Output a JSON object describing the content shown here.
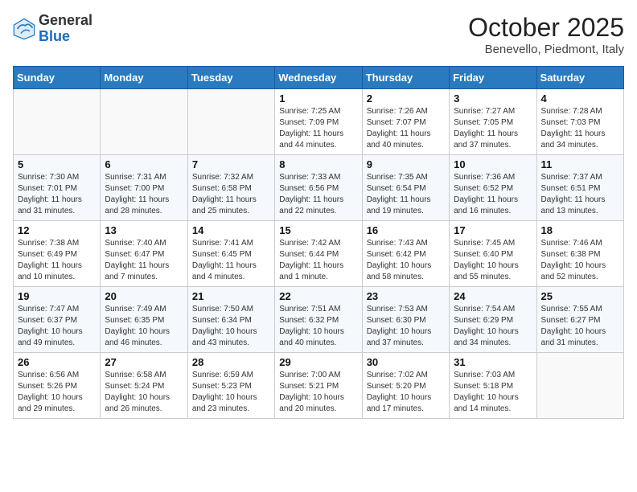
{
  "logo": {
    "general": "General",
    "blue": "Blue"
  },
  "header": {
    "month": "October 2025",
    "location": "Benevello, Piedmont, Italy"
  },
  "weekdays": [
    "Sunday",
    "Monday",
    "Tuesday",
    "Wednesday",
    "Thursday",
    "Friday",
    "Saturday"
  ],
  "weeks": [
    [
      {
        "day": "",
        "info": ""
      },
      {
        "day": "",
        "info": ""
      },
      {
        "day": "",
        "info": ""
      },
      {
        "day": "1",
        "info": "Sunrise: 7:25 AM\nSunset: 7:09 PM\nDaylight: 11 hours\nand 44 minutes."
      },
      {
        "day": "2",
        "info": "Sunrise: 7:26 AM\nSunset: 7:07 PM\nDaylight: 11 hours\nand 40 minutes."
      },
      {
        "day": "3",
        "info": "Sunrise: 7:27 AM\nSunset: 7:05 PM\nDaylight: 11 hours\nand 37 minutes."
      },
      {
        "day": "4",
        "info": "Sunrise: 7:28 AM\nSunset: 7:03 PM\nDaylight: 11 hours\nand 34 minutes."
      }
    ],
    [
      {
        "day": "5",
        "info": "Sunrise: 7:30 AM\nSunset: 7:01 PM\nDaylight: 11 hours\nand 31 minutes."
      },
      {
        "day": "6",
        "info": "Sunrise: 7:31 AM\nSunset: 7:00 PM\nDaylight: 11 hours\nand 28 minutes."
      },
      {
        "day": "7",
        "info": "Sunrise: 7:32 AM\nSunset: 6:58 PM\nDaylight: 11 hours\nand 25 minutes."
      },
      {
        "day": "8",
        "info": "Sunrise: 7:33 AM\nSunset: 6:56 PM\nDaylight: 11 hours\nand 22 minutes."
      },
      {
        "day": "9",
        "info": "Sunrise: 7:35 AM\nSunset: 6:54 PM\nDaylight: 11 hours\nand 19 minutes."
      },
      {
        "day": "10",
        "info": "Sunrise: 7:36 AM\nSunset: 6:52 PM\nDaylight: 11 hours\nand 16 minutes."
      },
      {
        "day": "11",
        "info": "Sunrise: 7:37 AM\nSunset: 6:51 PM\nDaylight: 11 hours\nand 13 minutes."
      }
    ],
    [
      {
        "day": "12",
        "info": "Sunrise: 7:38 AM\nSunset: 6:49 PM\nDaylight: 11 hours\nand 10 minutes."
      },
      {
        "day": "13",
        "info": "Sunrise: 7:40 AM\nSunset: 6:47 PM\nDaylight: 11 hours\nand 7 minutes."
      },
      {
        "day": "14",
        "info": "Sunrise: 7:41 AM\nSunset: 6:45 PM\nDaylight: 11 hours\nand 4 minutes."
      },
      {
        "day": "15",
        "info": "Sunrise: 7:42 AM\nSunset: 6:44 PM\nDaylight: 11 hours\nand 1 minute."
      },
      {
        "day": "16",
        "info": "Sunrise: 7:43 AM\nSunset: 6:42 PM\nDaylight: 10 hours\nand 58 minutes."
      },
      {
        "day": "17",
        "info": "Sunrise: 7:45 AM\nSunset: 6:40 PM\nDaylight: 10 hours\nand 55 minutes."
      },
      {
        "day": "18",
        "info": "Sunrise: 7:46 AM\nSunset: 6:38 PM\nDaylight: 10 hours\nand 52 minutes."
      }
    ],
    [
      {
        "day": "19",
        "info": "Sunrise: 7:47 AM\nSunset: 6:37 PM\nDaylight: 10 hours\nand 49 minutes."
      },
      {
        "day": "20",
        "info": "Sunrise: 7:49 AM\nSunset: 6:35 PM\nDaylight: 10 hours\nand 46 minutes."
      },
      {
        "day": "21",
        "info": "Sunrise: 7:50 AM\nSunset: 6:34 PM\nDaylight: 10 hours\nand 43 minutes."
      },
      {
        "day": "22",
        "info": "Sunrise: 7:51 AM\nSunset: 6:32 PM\nDaylight: 10 hours\nand 40 minutes."
      },
      {
        "day": "23",
        "info": "Sunrise: 7:53 AM\nSunset: 6:30 PM\nDaylight: 10 hours\nand 37 minutes."
      },
      {
        "day": "24",
        "info": "Sunrise: 7:54 AM\nSunset: 6:29 PM\nDaylight: 10 hours\nand 34 minutes."
      },
      {
        "day": "25",
        "info": "Sunrise: 7:55 AM\nSunset: 6:27 PM\nDaylight: 10 hours\nand 31 minutes."
      }
    ],
    [
      {
        "day": "26",
        "info": "Sunrise: 6:56 AM\nSunset: 5:26 PM\nDaylight: 10 hours\nand 29 minutes."
      },
      {
        "day": "27",
        "info": "Sunrise: 6:58 AM\nSunset: 5:24 PM\nDaylight: 10 hours\nand 26 minutes."
      },
      {
        "day": "28",
        "info": "Sunrise: 6:59 AM\nSunset: 5:23 PM\nDaylight: 10 hours\nand 23 minutes."
      },
      {
        "day": "29",
        "info": "Sunrise: 7:00 AM\nSunset: 5:21 PM\nDaylight: 10 hours\nand 20 minutes."
      },
      {
        "day": "30",
        "info": "Sunrise: 7:02 AM\nSunset: 5:20 PM\nDaylight: 10 hours\nand 17 minutes."
      },
      {
        "day": "31",
        "info": "Sunrise: 7:03 AM\nSunset: 5:18 PM\nDaylight: 10 hours\nand 14 minutes."
      },
      {
        "day": "",
        "info": ""
      }
    ]
  ]
}
